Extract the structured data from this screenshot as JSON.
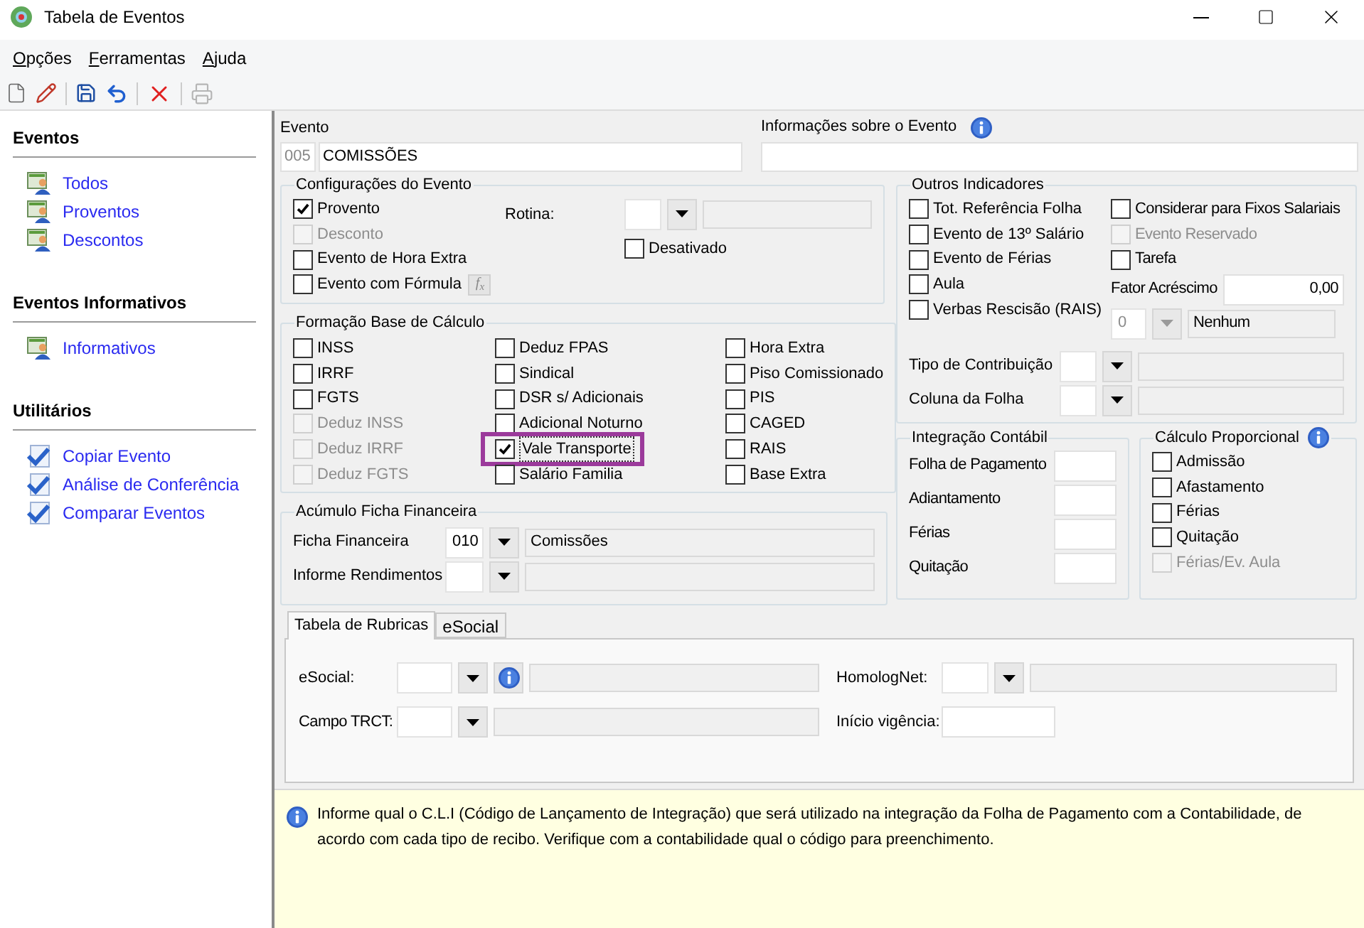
{
  "window": {
    "title": "Tabela de Eventos"
  },
  "menu": [
    {
      "label": "Opções"
    },
    {
      "label": "Ferramentas"
    },
    {
      "label": "Ajuda"
    }
  ],
  "sidebar": [
    {
      "title": "Eventos",
      "items": [
        {
          "label": "Todos",
          "kind": "group"
        },
        {
          "label": "Proventos",
          "kind": "group"
        },
        {
          "label": "Descontos",
          "kind": "group"
        }
      ]
    },
    {
      "title": "Eventos Informativos",
      "items": [
        {
          "label": "Informativos",
          "kind": "group"
        }
      ]
    },
    {
      "title": "Utilitários",
      "items": [
        {
          "label": "Copiar Evento",
          "kind": "check"
        },
        {
          "label": "Análise de Conferência",
          "kind": "check"
        },
        {
          "label": "Comparar Eventos",
          "kind": "check"
        }
      ]
    }
  ],
  "evento": {
    "label": "Evento",
    "code": "005",
    "name": "COMISSÕES"
  },
  "info_evento": {
    "label": "Informações sobre o Evento"
  },
  "configuracoes": {
    "title": "Configurações do Evento",
    "options": [
      {
        "label": "Provento",
        "checked": true,
        "disabled": false
      },
      {
        "label": "Desconto",
        "checked": false,
        "disabled": true
      },
      {
        "label": "Evento de Hora Extra",
        "checked": false,
        "disabled": false
      },
      {
        "label": "Evento com Fórmula",
        "checked": false,
        "disabled": false
      }
    ],
    "formula_button": "f$_{x}$",
    "rotina": {
      "label": "Rotina:"
    },
    "desativado": {
      "label": "Desativado",
      "checked": false,
      "disabled": false
    }
  },
  "formacao": {
    "title": "Formação Base de Cálculo",
    "columns": [
      [
        {
          "label": "INSS",
          "checked": false,
          "disabled": false
        },
        {
          "label": "IRRF",
          "checked": false,
          "disabled": false
        },
        {
          "label": "FGTS",
          "checked": false,
          "disabled": false
        },
        {
          "label": "Deduz INSS",
          "checked": false,
          "disabled": true
        },
        {
          "label": "Deduz IRRF",
          "checked": false,
          "disabled": true
        },
        {
          "label": "Deduz FGTS",
          "checked": false,
          "disabled": true
        }
      ],
      [
        {
          "label": "Deduz FPAS",
          "checked": false,
          "disabled": false
        },
        {
          "label": "Sindical",
          "checked": false,
          "disabled": false
        },
        {
          "label": "DSR s/ Adicionais",
          "checked": false,
          "disabled": false
        },
        {
          "label": "Adicional Noturno",
          "checked": false,
          "disabled": false
        },
        {
          "label": "Vale Transporte",
          "checked": true,
          "disabled": false,
          "highlighted": true
        },
        {
          "label": "Salário Familia",
          "checked": false,
          "disabled": false
        }
      ],
      [
        {
          "label": "Hora Extra",
          "checked": false,
          "disabled": false
        },
        {
          "label": "Piso Comissionado",
          "checked": false,
          "disabled": false
        },
        {
          "label": "PIS",
          "checked": false,
          "disabled": false
        },
        {
          "label": "CAGED",
          "checked": false,
          "disabled": false
        },
        {
          "label": "RAIS",
          "checked": false,
          "disabled": false
        },
        {
          "label": "Base Extra",
          "checked": false,
          "disabled": false
        }
      ]
    ]
  },
  "acumulo": {
    "title": "Acúmulo Ficha Financeira",
    "rows": [
      {
        "label": "Ficha Financeira",
        "code": "010",
        "description": "Comissões"
      },
      {
        "label": "Informe Rendimentos"
      }
    ]
  },
  "outros": {
    "title": "Outros Indicadores",
    "left": [
      {
        "label": "Tot. Referência Folha",
        "checked": false,
        "disabled": false
      },
      {
        "label": "Evento de 13º Salário",
        "checked": false,
        "disabled": false
      },
      {
        "label": "Evento de Férias",
        "checked": false,
        "disabled": false
      },
      {
        "label": "Aula",
        "checked": false,
        "disabled": false
      },
      {
        "label": "Verbas Rescisão (RAIS)",
        "checked": false,
        "disabled": false
      }
    ],
    "right": [
      {
        "label": "Considerar para Fixos Salariais",
        "checked": false,
        "disabled": false
      },
      {
        "label": "Evento Reservado",
        "checked": false,
        "disabled": true
      },
      {
        "label": "Tarefa",
        "checked": false,
        "disabled": false
      }
    ],
    "fator": {
      "label": "Fator Acréscimo",
      "value": "0,00"
    },
    "rescisao": {
      "code": "0",
      "description": "Nenhum",
      "disabled": true
    },
    "rows": [
      {
        "label": "Tipo de Contribuição"
      },
      {
        "label": "Coluna da Folha"
      }
    ]
  },
  "integracao": {
    "title": "Integração Contábil",
    "fields": [
      {
        "label": "Folha de Pagamento"
      },
      {
        "label": "Adiantamento"
      },
      {
        "label": "Férias"
      },
      {
        "label": "Quitação"
      }
    ]
  },
  "calculo": {
    "title": "Cálculo Proporcional",
    "options": [
      {
        "label": "Admissão",
        "checked": false,
        "disabled": false
      },
      {
        "label": "Afastamento",
        "checked": false,
        "disabled": false
      },
      {
        "label": "Férias",
        "checked": false,
        "disabled": false
      },
      {
        "label": "Quitação",
        "checked": false,
        "disabled": false
      },
      {
        "label": "Férias/Ev. Aula",
        "checked": false,
        "disabled": true
      }
    ]
  },
  "tabs": [
    {
      "label": "Tabela de Rubricas",
      "selected": true
    },
    {
      "label": "eSocial",
      "selected": false
    }
  ],
  "rubricas": {
    "esocial": {
      "label": "eSocial:"
    },
    "homolognet": {
      "label": "HomologNet:"
    },
    "campo_trct": {
      "label": "Campo TRCT:"
    },
    "inicio": {
      "label": "Início vigência:"
    }
  },
  "help": {
    "text": "Informe qual o C.L.I (Código de Lançamento de Integração) que será utilizado na integração da Folha de Pagamento com a Contabilidade, de acordo com cada tipo de recibo. Verifique com a contabilidade qual o código para preenchimento."
  }
}
